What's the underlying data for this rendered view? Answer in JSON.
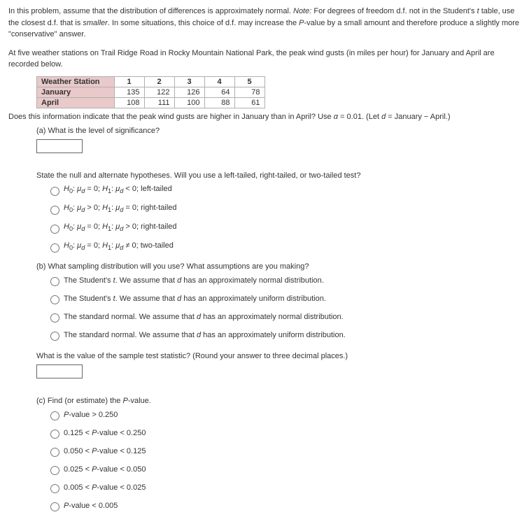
{
  "intro": {
    "p1": "In this problem, assume that the distribution of differences is approximately normal. ",
    "note_label": "Note:",
    "note_body": " For degrees of freedom d.f. not in the Student's ",
    "note_t": "t",
    "note_body2": " table, use the closest d.f. that is ",
    "smaller": "smaller",
    "note_body3": ". In some situations, this choice of d.f. may increase the ",
    "pval": "P",
    "note_body4": "-value by a small amount and therefore produce a slightly more \"conservative\" answer."
  },
  "context": "At five weather stations on Trail Ridge Road in Rocky Mountain National Park, the peak wind gusts (in miles per hour) for January and April are recorded below.",
  "table": {
    "head": "Weather Station",
    "cols": [
      "1",
      "2",
      "3",
      "4",
      "5"
    ],
    "rows": [
      {
        "label": "January",
        "vals": [
          "135",
          "122",
          "126",
          "64",
          "78"
        ]
      },
      {
        "label": "April",
        "vals": [
          "108",
          "111",
          "100",
          "88",
          "61"
        ]
      }
    ]
  },
  "q_main_a": "Does this information indicate that the peak wind gusts are higher in January than in April? Use ",
  "q_main_alpha": "α",
  "q_main_b": " = 0.01. (Let ",
  "q_main_d": "d",
  "q_main_c": " = January − April.)",
  "parts": {
    "a_label": "(a) What is the level of significance?",
    "a_state": "State the null and alternate hypotheses. Will you use a left-tailed, right-tailed, or two-tailed test?",
    "a_opts": [
      "H₀: μ_d = 0; H₁: μ_d < 0; left-tailed",
      "H₀: μ_d > 0; H₁: μ_d = 0; right-tailed",
      "H₀: μ_d = 0; H₁: μ_d > 0; right-tailed",
      "H₀: μ_d = 0; H₁: μ_d ≠ 0; two-tailed"
    ],
    "b_label_a": "(b) What sampling distribution will you use? What assumptions are you making?",
    "b_opts": [
      "The Student's t. We assume that d has an approximately normal distribution.",
      "The Student's t. We assume that d has an approximately uniform distribution.",
      "The standard normal. We assume that d has an approximately normal distribution.",
      "The standard normal. We assume that d has an approximately uniform distribution."
    ],
    "b_stat": "What is the value of the sample test statistic? (Round your answer to three decimal places.)",
    "c_label_a": "(c) Find (or estimate) the ",
    "c_label_b": "-value.",
    "c_opts": [
      "P-value > 0.250",
      "0.125 < P-value < 0.250",
      "0.050 < P-value < 0.125",
      "0.025 < P-value < 0.050",
      "0.005 < P-value < 0.025",
      "P-value < 0.005"
    ]
  },
  "chart_data": {
    "type": "table",
    "title": "Peak wind gusts (mph) by weather station",
    "columns": [
      "Weather Station",
      "1",
      "2",
      "3",
      "4",
      "5"
    ],
    "rows": [
      {
        "label": "January",
        "values": [
          135,
          122,
          126,
          64,
          78
        ]
      },
      {
        "label": "April",
        "values": [
          108,
          111,
          100,
          88,
          61
        ]
      }
    ]
  }
}
